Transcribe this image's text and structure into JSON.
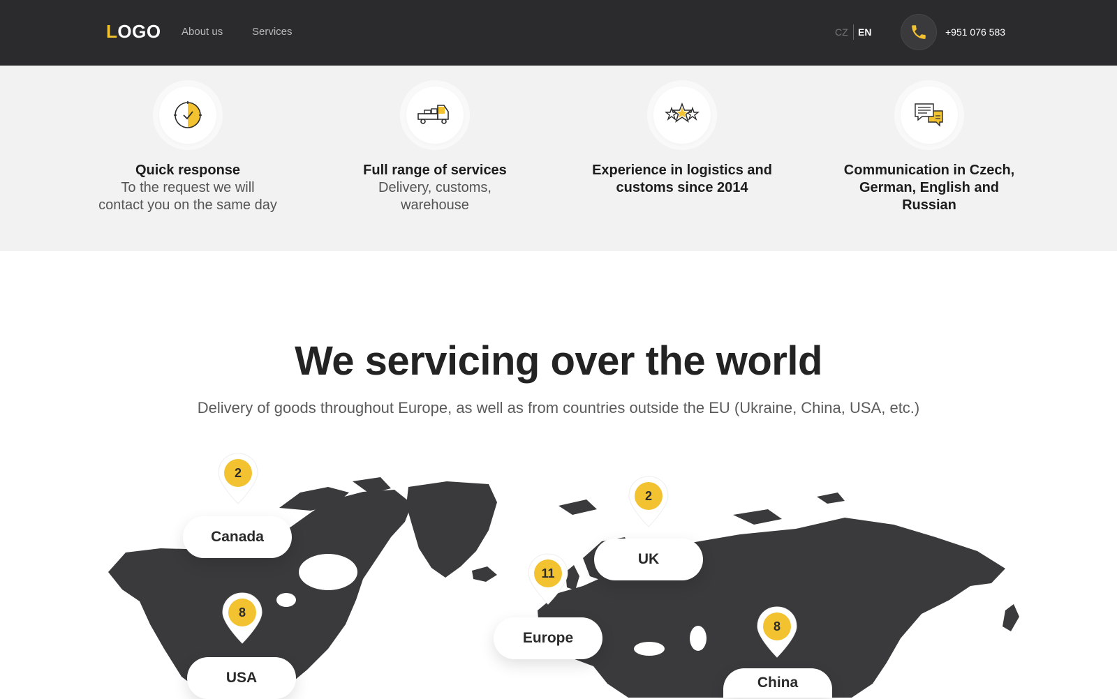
{
  "header": {
    "logo_initial": "L",
    "logo_rest": "OGO",
    "nav": [
      "About us",
      "Services"
    ],
    "languages": [
      "CZ",
      "EN"
    ],
    "active_language": "EN",
    "phone": "+951 076 583",
    "phone_icon": "phone-icon"
  },
  "features": [
    {
      "icon": "clock-icon",
      "title": "Quick response",
      "description": "To the request we will contact you on the same day"
    },
    {
      "icon": "truck-icon",
      "title": "Full range of services",
      "description": "Delivery, customs, warehouse"
    },
    {
      "icon": "stars-icon",
      "title": "Experience in logistics and customs since 2014",
      "description": ""
    },
    {
      "icon": "chat-icon",
      "title": "Communication in Czech, German, English and Russian",
      "description": ""
    }
  ],
  "world": {
    "heading": "We servicing over the world",
    "subheading": "Delivery of goods throughout Europe, as well as from countries outside the EU (Ukraine, China, USA, etc.)",
    "regions": [
      {
        "name": "Canada",
        "count": "2"
      },
      {
        "name": "USA",
        "count": "8"
      },
      {
        "name": "UK",
        "count": "2"
      },
      {
        "name": "Europe",
        "count": "11"
      },
      {
        "name": "China",
        "count": "8"
      }
    ]
  },
  "colors": {
    "accent": "#f2c230",
    "header_bg": "#2b2b2d",
    "map_land": "#3a3a3c",
    "features_bg": "#f2f2f2"
  }
}
